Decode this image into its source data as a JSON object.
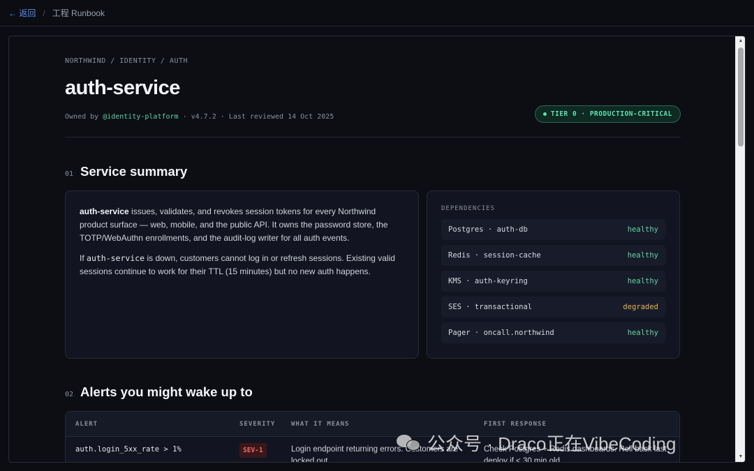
{
  "topbar": {
    "back_label": "← 返回",
    "separator": "/",
    "crumb": "工程 Runbook"
  },
  "header": {
    "path": "NORTHWIND / IDENTITY / AUTH",
    "title": "auth-service",
    "meta_prefix": "Owned by ",
    "owner": "@identity-platform",
    "meta_suffix": " · v4.7.2 · Last reviewed 14 Oct 2025",
    "tier_badge": "TIER 0 · PRODUCTION-CRITICAL"
  },
  "sections": [
    {
      "num": "01",
      "title": "Service summary"
    },
    {
      "num": "02",
      "title": "Alerts you might wake up to"
    }
  ],
  "summary": {
    "p1_bold": "auth-service",
    "p1_rest": " issues, validates, and revokes session tokens for every Northwind product surface — web, mobile, and the public API. It owns the password store, the TOTP/WebAuthn enrollments, and the audit-log writer for all auth events.",
    "p2_prefix": "If ",
    "p2_code": "auth-service",
    "p2_rest": " is down, customers cannot log in or refresh sessions. Existing valid sessions continue to work for their TTL (15 minutes) but no new auth happens."
  },
  "dependencies": {
    "label": "DEPENDENCIES",
    "items": [
      {
        "name": "Postgres · auth-db",
        "status": "healthy"
      },
      {
        "name": "Redis · session-cache",
        "status": "healthy"
      },
      {
        "name": "KMS · auth-keyring",
        "status": "healthy"
      },
      {
        "name": "SES · transactional",
        "status": "degraded"
      },
      {
        "name": "Pager · oncall.northwind",
        "status": "healthy"
      }
    ]
  },
  "alerts": {
    "columns": [
      "ALERT",
      "SEVERITY",
      "WHAT IT MEANS",
      "FIRST RESPONSE"
    ],
    "rows": [
      {
        "alert": "auth.login_5xx_rate > 1%",
        "severity": "SEV-1",
        "meaning": "Login endpoint returning errors. Customers are locked out.",
        "response": "Check Postgres + Redis dashboards. Roll back last deploy if < 30 min old."
      }
    ]
  },
  "watermark": "公众号 · Draco正在VibeCoding",
  "colors": {
    "accent_link": "#5b8def",
    "healthy": "#5fd3a2",
    "degraded": "#e6b44c",
    "sev1": "#f06a6a"
  }
}
